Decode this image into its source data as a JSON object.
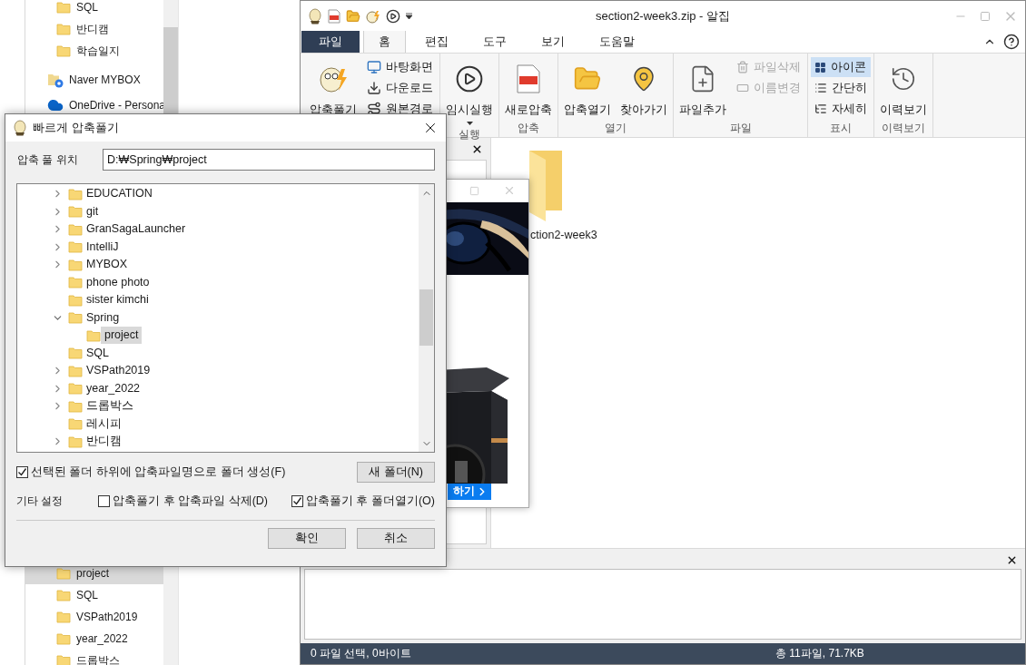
{
  "explorer": {
    "top_items": [
      {
        "label": "SQL",
        "kind": "folder",
        "selected": false
      },
      {
        "label": "반디캠",
        "kind": "folder",
        "selected": false
      },
      {
        "label": "학습일지",
        "kind": "folder",
        "selected": false
      },
      {
        "label": "Naver MYBOX",
        "kind": "mybox",
        "selected": false
      },
      {
        "label": "OneDrive - Persona",
        "kind": "onedrive",
        "selected": false
      }
    ],
    "bottom_items": [
      {
        "label": "project",
        "kind": "folder",
        "selected": true
      },
      {
        "label": "SQL",
        "kind": "folder",
        "selected": false
      },
      {
        "label": "VSPath2019",
        "kind": "folder",
        "selected": false
      },
      {
        "label": "year_2022",
        "kind": "folder",
        "selected": false
      },
      {
        "label": "드롭박스",
        "kind": "folder",
        "selected": false
      }
    ]
  },
  "alzip": {
    "title": "section2-week3.zip - 알집",
    "tabs": [
      {
        "label": "파일",
        "kind": "file",
        "selected": false
      },
      {
        "label": "홈",
        "kind": "tab",
        "selected": true
      },
      {
        "label": "편집",
        "kind": "tab",
        "selected": false
      },
      {
        "label": "도구",
        "kind": "tab",
        "selected": false
      },
      {
        "label": "보기",
        "kind": "tab",
        "selected": false
      },
      {
        "label": "도움말",
        "kind": "tab",
        "selected": false
      }
    ],
    "ribbon": [
      {
        "items": [
          {
            "label": "압축풀기",
            "kind": "large"
          },
          {
            "label": "바탕화면",
            "kind": "small"
          },
          {
            "label": "다운로드",
            "kind": "small"
          },
          {
            "label": "원본경로",
            "kind": "small"
          }
        ]
      },
      {
        "label": "실행",
        "items": [
          {
            "label": "임시실행",
            "kind": "large_menu"
          }
        ]
      },
      {
        "label": "압축",
        "items": [
          {
            "label": "새로압축",
            "kind": "large"
          }
        ]
      },
      {
        "label": "열기",
        "items": [
          {
            "label": "압축열기",
            "kind": "large"
          },
          {
            "label": "찾아가기",
            "kind": "large"
          }
        ]
      },
      {
        "label": "파일",
        "items": [
          {
            "label": "파일추가",
            "kind": "large",
            "disabled": false
          },
          {
            "label": "파일삭제",
            "kind": "small",
            "disabled": true
          },
          {
            "label": "이름변경",
            "kind": "small",
            "disabled": true
          }
        ]
      },
      {
        "label": "표시",
        "items": [
          {
            "label": "아이콘",
            "kind": "small",
            "selected": true
          },
          {
            "label": "간단히",
            "kind": "small",
            "selected": false
          },
          {
            "label": "자세히",
            "kind": "small",
            "selected": false
          }
        ]
      },
      {
        "label": "이력보기",
        "items": [
          {
            "label": "이력보기",
            "kind": "large"
          }
        ]
      }
    ],
    "files": [
      {
        "label": "ction2-week3"
      }
    ],
    "status_bar": {
      "left": "0 파일 선택, 0바이트",
      "right": "총 11파일, 71.7KB"
    }
  },
  "ad": {
    "button": "하기"
  },
  "dialog": {
    "title": "빠르게 압축풀기",
    "path_label": "압축 풀 위치",
    "path_value": "D:₩Spring₩project",
    "tree": [
      {
        "label": "EDUCATION",
        "kind": "branch",
        "expanded": false,
        "selected": false
      },
      {
        "label": "git",
        "kind": "branch",
        "expanded": false,
        "selected": false
      },
      {
        "label": "GranSagaLauncher",
        "kind": "branch",
        "expanded": false,
        "selected": false
      },
      {
        "label": "IntelliJ",
        "kind": "branch",
        "expanded": false,
        "selected": false
      },
      {
        "label": "MYBOX",
        "kind": "branch",
        "expanded": false,
        "selected": false
      },
      {
        "label": "phone photo",
        "kind": "leaf",
        "selected": false
      },
      {
        "label": "sister kimchi",
        "kind": "leaf",
        "selected": false
      },
      {
        "label": "Spring",
        "kind": "branch",
        "expanded": true,
        "selected": false,
        "children": [
          {
            "label": "project",
            "kind": "leaf",
            "selected": true
          }
        ]
      },
      {
        "label": "SQL",
        "kind": "leaf",
        "selected": false
      },
      {
        "label": "VSPath2019",
        "kind": "branch",
        "expanded": false,
        "selected": false
      },
      {
        "label": "year_2022",
        "kind": "branch",
        "expanded": false,
        "selected": false
      },
      {
        "label": "드롭박스",
        "kind": "branch",
        "expanded": false,
        "selected": false
      },
      {
        "label": "레시피",
        "kind": "leaf",
        "selected": false
      },
      {
        "label": "반디캠",
        "kind": "branch",
        "expanded": false,
        "selected": false
      }
    ],
    "create_folder": {
      "label": "선택된 폴더 하위에 압축파일명으로 폴더 생성(F)",
      "checked": true
    },
    "new_folder_button": "새 폴더(N)",
    "other_label": "기타 설정",
    "options": [
      {
        "label": "압축풀기 후 압축파일 삭제(D)",
        "checked": false
      },
      {
        "label": "압축풀기 후 폴더열기(O)",
        "checked": true
      }
    ],
    "buttons": [
      "확인",
      "취소"
    ]
  }
}
